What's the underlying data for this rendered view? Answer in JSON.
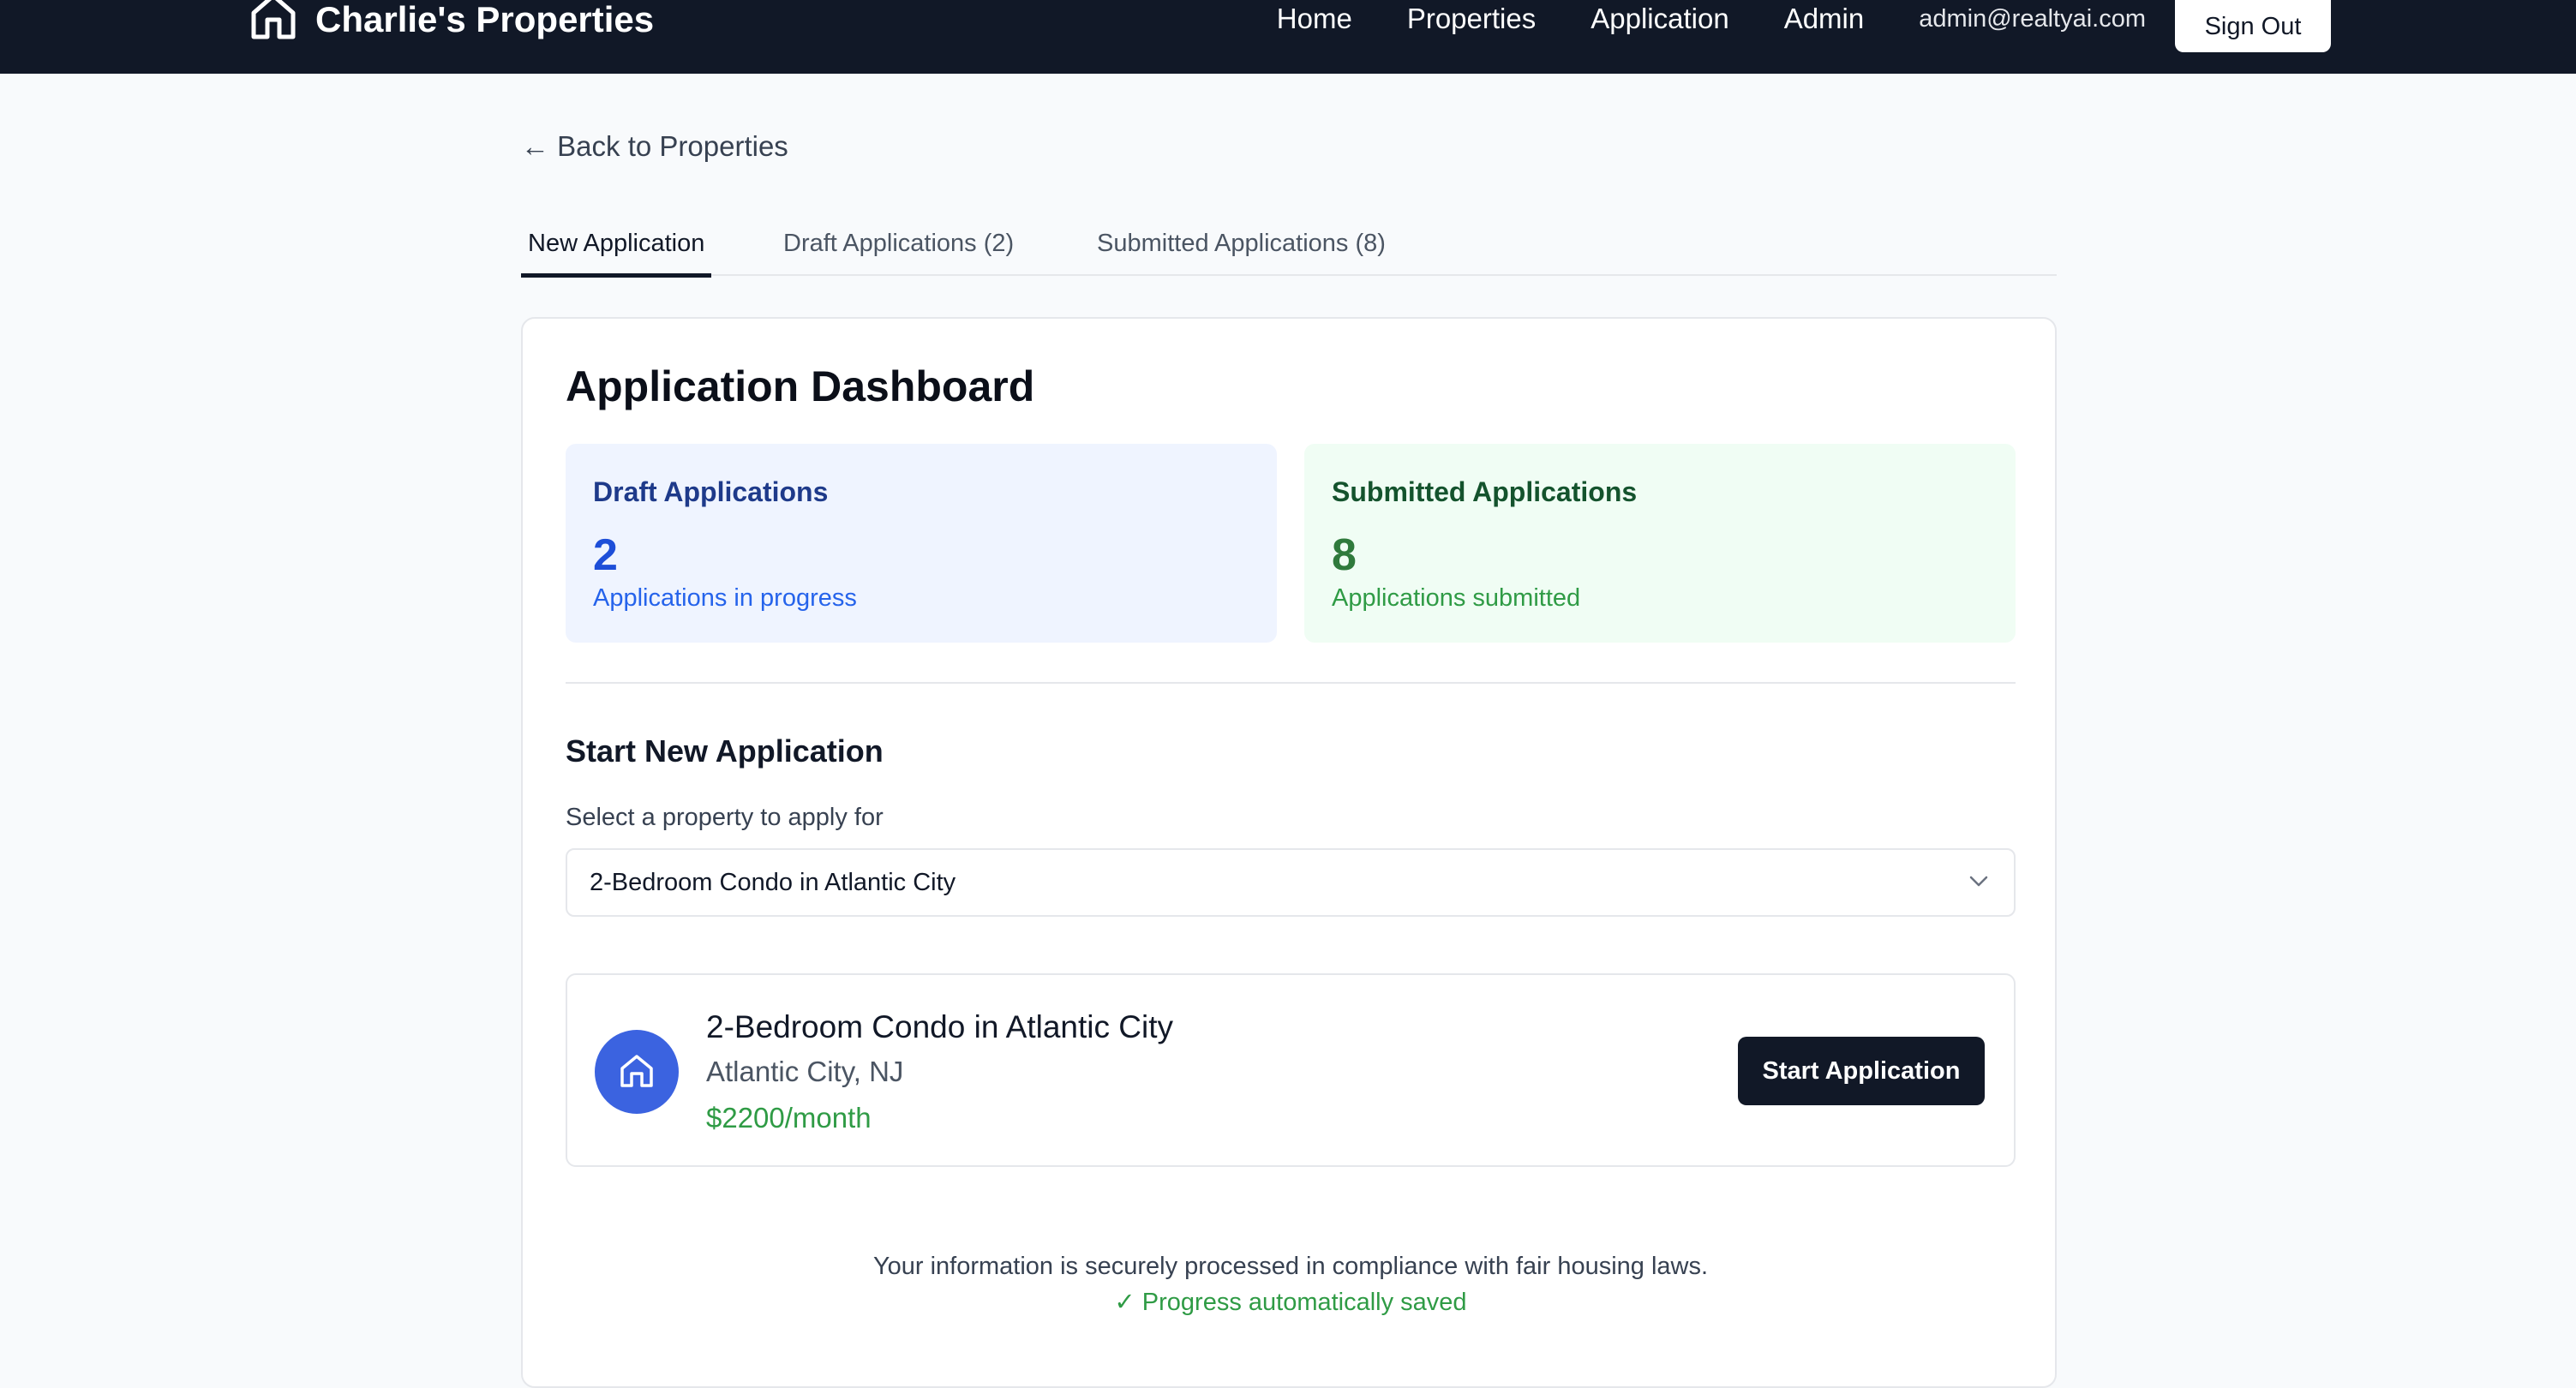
{
  "header": {
    "brand": "Charlie's Properties",
    "brand_icon": "home-icon",
    "nav": [
      "Home",
      "Properties",
      "Application",
      "Admin"
    ],
    "user_email": "admin@realtyai.com",
    "sign_out": "Sign Out"
  },
  "back_link": "← Back to Properties",
  "tabs": {
    "new": "New Application",
    "draft": "Draft Applications (2)",
    "submitted": "Submitted Applications (8)",
    "active": "New Application"
  },
  "dashboard": {
    "title": "Application Dashboard",
    "draft": {
      "label": "Draft Applications",
      "count": "2",
      "description": "Applications in progress"
    },
    "submitted": {
      "label": "Submitted Applications",
      "count": "8",
      "description": "Applications submitted"
    }
  },
  "new_application": {
    "title": "Start New Application",
    "select_label": "Select a property to apply for",
    "selected_property": "2-Bedroom Condo in Atlantic City"
  },
  "property": {
    "name": "2-Bedroom Condo in Atlantic City",
    "location": "Atlantic City, NJ",
    "price": "$2200/month",
    "icon": "home-icon",
    "button": "Start Application"
  },
  "footer": {
    "secure_note": "Your information is securely processed in compliance with fair housing laws.",
    "saved_note": "✓ Progress automatically saved"
  },
  "colors": {
    "header_bg": "#111827",
    "accent_blue": "#3b63e0",
    "success_green": "#2f9b45"
  }
}
